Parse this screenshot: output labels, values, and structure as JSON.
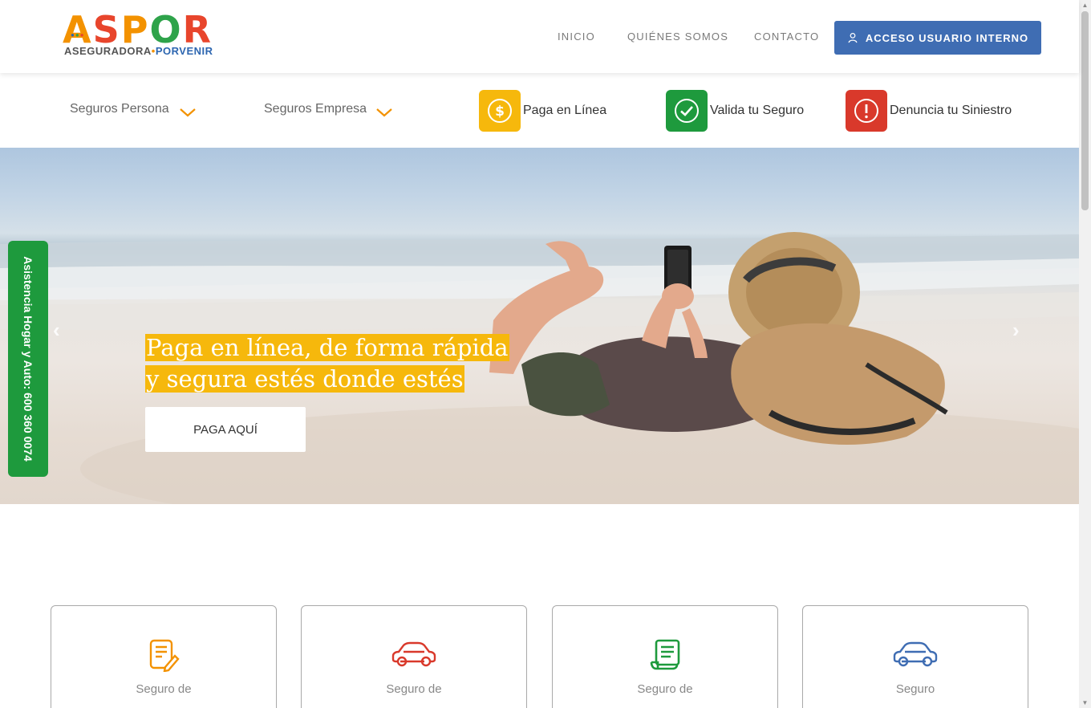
{
  "brand": {
    "logo_letters": [
      "A",
      "S",
      "P",
      "O",
      "R"
    ],
    "logo_sub_left": "ASEGURADORA",
    "logo_sub_dot": "•",
    "logo_sub_right": "PORVENIR"
  },
  "nav": {
    "inicio": "INICIO",
    "quienes": "QUIÉNES SOMOS",
    "contacto": "CONTACTO",
    "acceso": "ACCESO USUARIO INTERNO"
  },
  "subnav": {
    "personas": "Seguros Persona",
    "empresa": "Seguros Empresa",
    "quick": [
      {
        "label": "Paga en Línea",
        "icon": "dollar-icon",
        "color": "#f6b80c"
      },
      {
        "label": "Valida tu Seguro",
        "icon": "check-icon",
        "color": "#1e9a3d"
      },
      {
        "label": "Denuncia tu Siniestro",
        "icon": "exclamation-icon",
        "color": "#d9392b"
      }
    ]
  },
  "hero": {
    "line1": "Paga en línea, de forma rápida",
    "line2": "y segura estés donde estés",
    "button": "PAGA AQUÍ",
    "prev": "‹",
    "next": "›"
  },
  "sidetab": {
    "text": "Asistencia Hogar y Auto: 600 360 0074"
  },
  "cards": [
    {
      "title": "Seguro de",
      "icon": "document-edit-icon",
      "color": "#f39200"
    },
    {
      "title": "Seguro de",
      "icon": "car-icon",
      "color": "#d9392b"
    },
    {
      "title": "Seguro de",
      "icon": "scroll-document-icon",
      "color": "#1e9a3d"
    },
    {
      "title": "Seguro",
      "icon": "car-icon",
      "color": "#3f6db3"
    }
  ],
  "colors": {
    "accent_blue": "#3f6db3",
    "accent_yellow": "#f6b80c",
    "accent_green": "#1e9a3d",
    "accent_red": "#d9392b"
  }
}
